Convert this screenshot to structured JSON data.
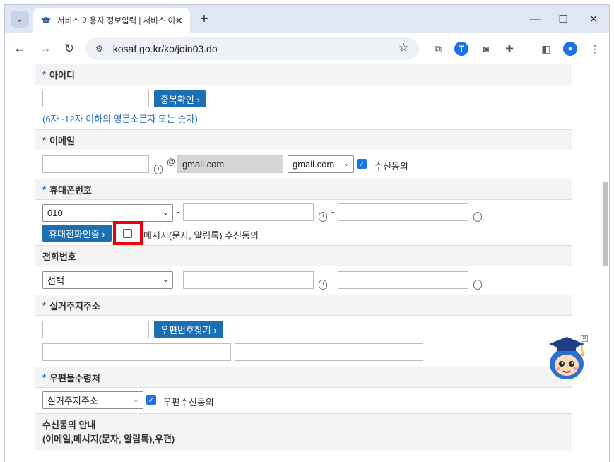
{
  "browser": {
    "tab_title": "서비스 이용자 정보입력 | 서비스 이용자",
    "tab_close": "✕",
    "new_tab": "+",
    "url": "kosaf.go.kr/ko/join03.do",
    "window_minimize": "—",
    "window_maximize": "☐",
    "window_close": "✕",
    "icons": [
      "tab-search-icon",
      "graduation-cap-icon",
      "back-icon",
      "forward-icon",
      "reload-icon",
      "site-info-icon",
      "star-icon",
      "copy-icon",
      "translate-icon",
      "camera-icon",
      "extensions-icon",
      "side-panel-icon",
      "profile-icon",
      "menu-icon"
    ]
  },
  "form": {
    "userid": {
      "label": "아이디",
      "required": "*",
      "check_button": "중복확인 ›",
      "hint": "(6자~12자 이하의 영문소문자 또는 숫자)"
    },
    "email": {
      "label": "이메일",
      "required": "*",
      "at": "@",
      "domain_value": "gmail.com",
      "domain_select": "gmail.com",
      "consent_label": "수신동의",
      "consent_checked": true
    },
    "mobile": {
      "label": "휴대폰번호",
      "required": "*",
      "prefix_select": "010",
      "dash1": "-",
      "dash2": "-",
      "verify_button": "휴대전화인증 ›",
      "consent_label": "메시지(문자, 알림톡) 수신동의",
      "consent_checked": false
    },
    "phone": {
      "label": "전화번호",
      "prefix_select": "선택",
      "dash1": "-",
      "dash2": "-"
    },
    "address": {
      "label": "실거주지주소",
      "required": "*",
      "search_button": "우편번호찾기 ›"
    },
    "mail_dest": {
      "label": "우편물수령처",
      "required": "*",
      "select_value": "실거주지주소",
      "consent_label": "우편수신동의",
      "consent_checked": true
    },
    "consent_info": {
      "line1": "수신동의 안내",
      "line2": "(이메일,메시지(문자, 알림톡),우편)"
    }
  },
  "colors": {
    "accent": "#1b6fb5",
    "required_star": "#2a6bb8",
    "highlight_box": "#e8000a",
    "checkbox": "#1a73e8"
  }
}
